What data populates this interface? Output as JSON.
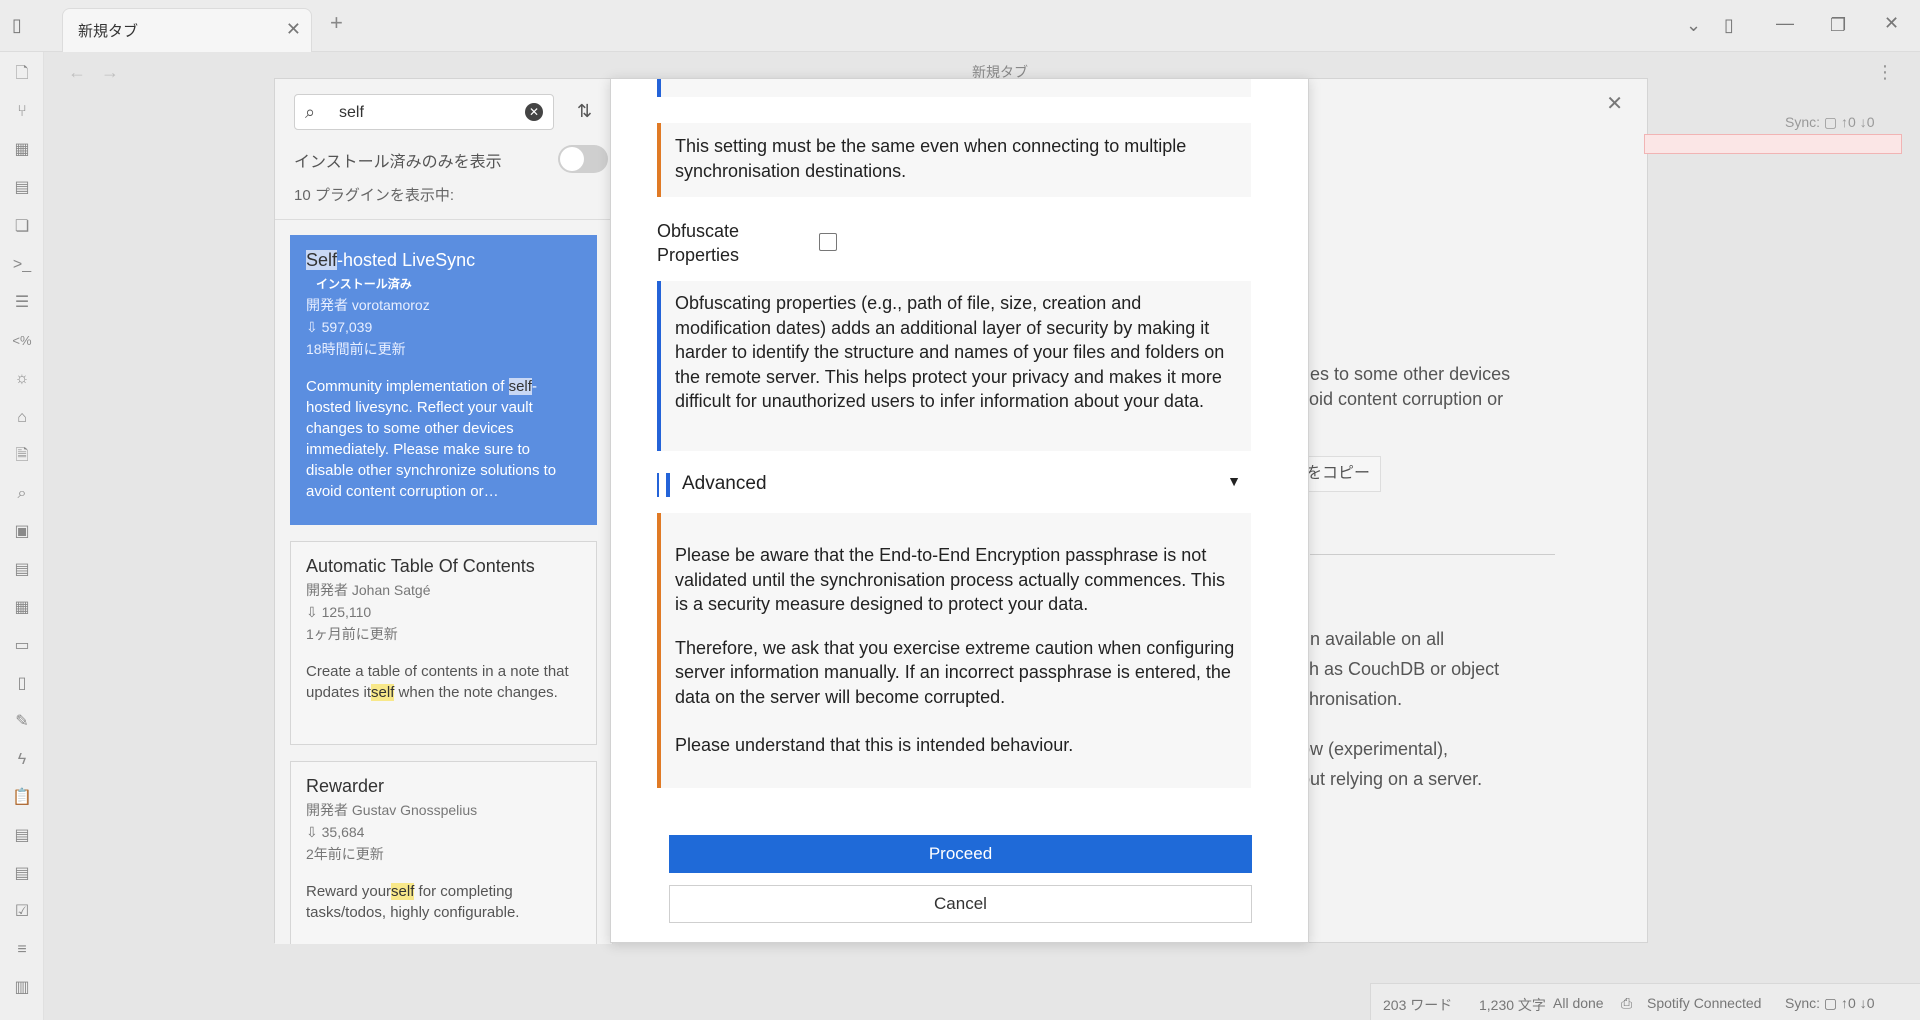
{
  "tabbar": {
    "tab_title": "新規タブ",
    "new_tab": "+"
  },
  "main": {
    "title": "新規タブ"
  },
  "plugins": {
    "search_value": "self",
    "installed_only_label": "インストール済みのみを表示",
    "count_label": "10 プラグインを表示中:",
    "cards": [
      {
        "name_hl": "Self",
        "name_rest": "-hosted LiveSync",
        "badge": "インストール済み",
        "author": "開発者 vorotamoroz",
        "downloads": "597,039",
        "updated": "18時間前に更新",
        "desc_pre": "Community implementation of ",
        "desc_hl": "self",
        "desc_post": "-hosted livesync. Reflect your vault changes to some other devices immediately. Please make sure to disable other synchronize solutions to avoid content corruption or…"
      },
      {
        "name": "Automatic Table Of Contents",
        "author": "開発者 Johan Satgé",
        "downloads": "125,110",
        "updated": "1ヶ月前に更新",
        "desc_pre": "Create a table of contents in a note that updates it",
        "desc_hl": "self",
        "desc_post": " when the note changes."
      },
      {
        "name": "Rewarder",
        "author": "開発者 Gustav Gnosspelius",
        "downloads": "35,684",
        "updated": "2年前に更新",
        "desc_pre": "Reward your",
        "desc_hl": "self",
        "desc_post": " for completing tasks/todos, highly configurable."
      }
    ]
  },
  "background_detail": {
    "sync_label": "Sync:",
    "sync_counts": "↑0 ↓0",
    "line1": "nges to some other devices",
    "line2": "avoid content corruption or",
    "copy_button": "をコピー",
    "line3": "g-in available on all",
    "line4": "uch as CouchDB or object",
    "line5": "nchronisation.",
    "line6": "now (experimental),",
    "line7": "hout relying on a server."
  },
  "dialog": {
    "block_same_setting": "This setting must be the same even when connecting to multiple synchronisation destinations.",
    "obfuscate_label_1": "Obfuscate",
    "obfuscate_label_2": "Properties",
    "obfuscate_info": "Obfuscating properties (e.g., path of file, size, creation and modification dates) adds an additional layer of security by making it harder to identify the structure and names of your files and folders on the remote server. This helps protect your privacy and makes it more difficult for unauthorized users to infer information about your data.",
    "advanced_label": "Advanced",
    "warn_p1": "Please be aware that the End-to-End Encryption passphrase is not validated until the synchronisation process actually commences. This is a security measure designed to protect your data.",
    "warn_p2": "Therefore, we ask that you exercise extreme caution when configuring server information manually. If an incorrect passphrase is entered, the data on the server will become corrupted.",
    "warn_p3": "Please understand that this is intended behaviour.",
    "proceed_label": "Proceed",
    "cancel_label": "Cancel"
  },
  "statusbar": {
    "words": "203 ワード",
    "chars": "1,230 文字",
    "status": "All done",
    "spotify": "Spotify Connected",
    "sync_label": "Sync:",
    "sync_counts": "↑0 ↓0"
  },
  "colors": {
    "accent": "#1f6ad8",
    "selected_card": "#5b8ee0",
    "warning_border": "#e07a25",
    "info_border": "#2463d8"
  }
}
